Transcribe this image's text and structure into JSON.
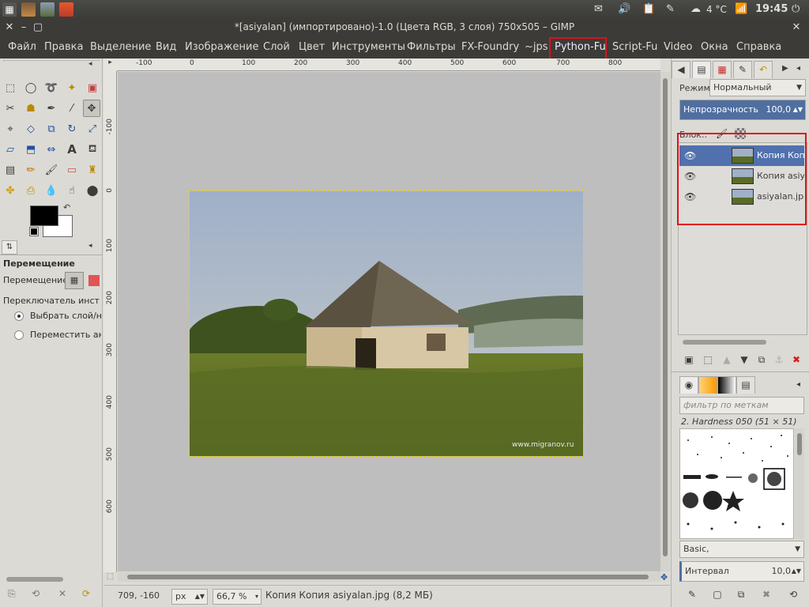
{
  "window": {
    "title": "*[asiyalan] (импортировано)-1.0 (Цвета RGB, 3 слоя) 750x505 – GIMP"
  },
  "system_tray": {
    "weather": "4 °C",
    "clock": "19:45"
  },
  "menubar": {
    "items": [
      {
        "label": "Файл"
      },
      {
        "label": "Правка"
      },
      {
        "label": "Выделение"
      },
      {
        "label": "Вид"
      },
      {
        "label": "Изображение"
      },
      {
        "label": "Слой"
      },
      {
        "label": "Цвет"
      },
      {
        "label": "Инструменты"
      },
      {
        "label": "Фильтры"
      },
      {
        "label": "FX-Foundry"
      },
      {
        "label": "~jps"
      },
      {
        "label": "Python-Fu",
        "highlighted": true
      },
      {
        "label": "Script-Fu"
      },
      {
        "label": "Video"
      },
      {
        "label": "Окна"
      },
      {
        "label": "Справка"
      }
    ]
  },
  "tool_options": {
    "title": "Перемещение",
    "move_label": "Перемещение:",
    "switch_label": "Переключатель инструм",
    "radio_pick": "Выбрать слой/нап",
    "radio_move_active": "Переместить акти"
  },
  "rulers": {
    "horizontal": [
      "-100",
      "0",
      "100",
      "200",
      "300",
      "400",
      "500",
      "600",
      "700",
      "800"
    ],
    "vertical": [
      "-100",
      "0",
      "100",
      "200",
      "300",
      "400",
      "500",
      "600"
    ]
  },
  "image": {
    "watermark": "www.migranov.ru"
  },
  "statusbar": {
    "coords": "709, -160",
    "unit": "px",
    "zoom": "66,7 %",
    "info": "Копия Копия asiyalan.jpg (8,2 МБ)"
  },
  "layers_panel": {
    "mode_label": "Режим:",
    "mode_value": "Нормальный",
    "opacity_label": "Непрозрачность",
    "opacity_value": "100,0",
    "lock_label": "Блок.:",
    "layers": [
      {
        "name": "Копия Копия",
        "selected": true
      },
      {
        "name": "Копия asiyal",
        "selected": false
      },
      {
        "name": "asiyalan.jpg",
        "selected": false
      }
    ]
  },
  "brushes_panel": {
    "filter_placeholder": "фильтр по меткам",
    "brush_name": "2. Hardness 050 (51 × 51)",
    "preset": "Basic,",
    "interval_label": "Интервал",
    "interval_value": "10,0"
  },
  "colors": {
    "selection_highlight": "#e0101a",
    "layer_selected": "#5071ad",
    "opacity_bar": "#4f6fa0"
  }
}
